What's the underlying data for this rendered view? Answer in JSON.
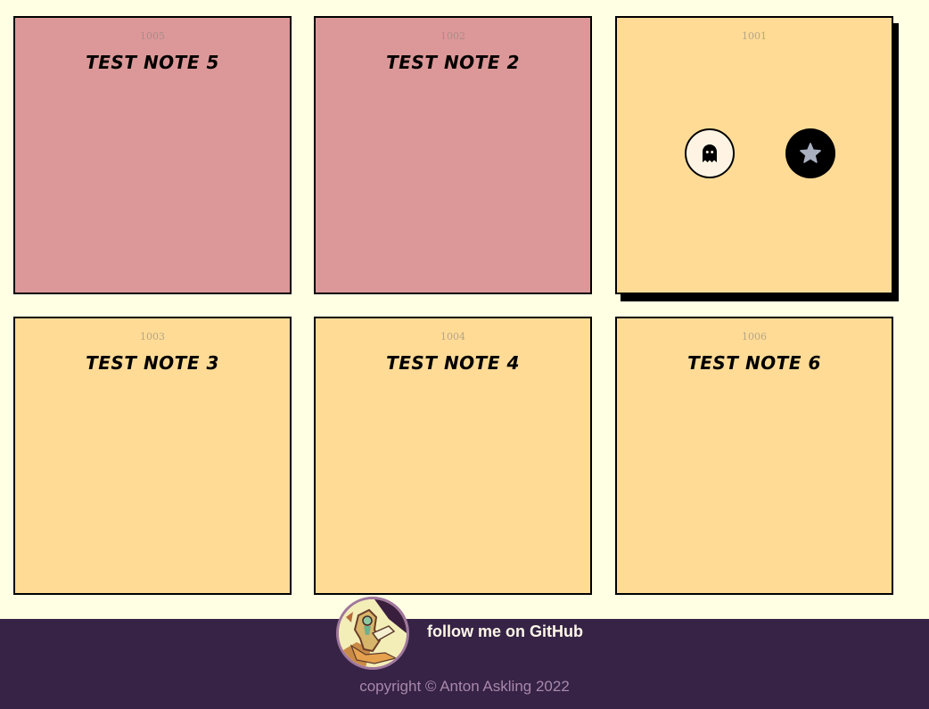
{
  "notes": [
    {
      "id": "1005",
      "title": "test note 5",
      "color": "#dc9898"
    },
    {
      "id": "1002",
      "title": "test note 2",
      "color": "#dc9898"
    },
    {
      "id": "1001",
      "title": "",
      "color": "#ffdb96",
      "hovered": true,
      "actions": [
        {
          "icon": "ghost-icon"
        },
        {
          "icon": "star-icon"
        }
      ]
    },
    {
      "id": "1003",
      "title": "test note 3",
      "color": "#ffdb96"
    },
    {
      "id": "1004",
      "title": "test note 4",
      "color": "#ffdb96"
    },
    {
      "id": "1006",
      "title": "test note 6",
      "color": "#ffdb96"
    }
  ],
  "footer": {
    "avatar_icon": "avatar",
    "github_label": "follow me on GitHub",
    "copyright": "copyright © Anton Askling 2022",
    "background": "#362346"
  }
}
